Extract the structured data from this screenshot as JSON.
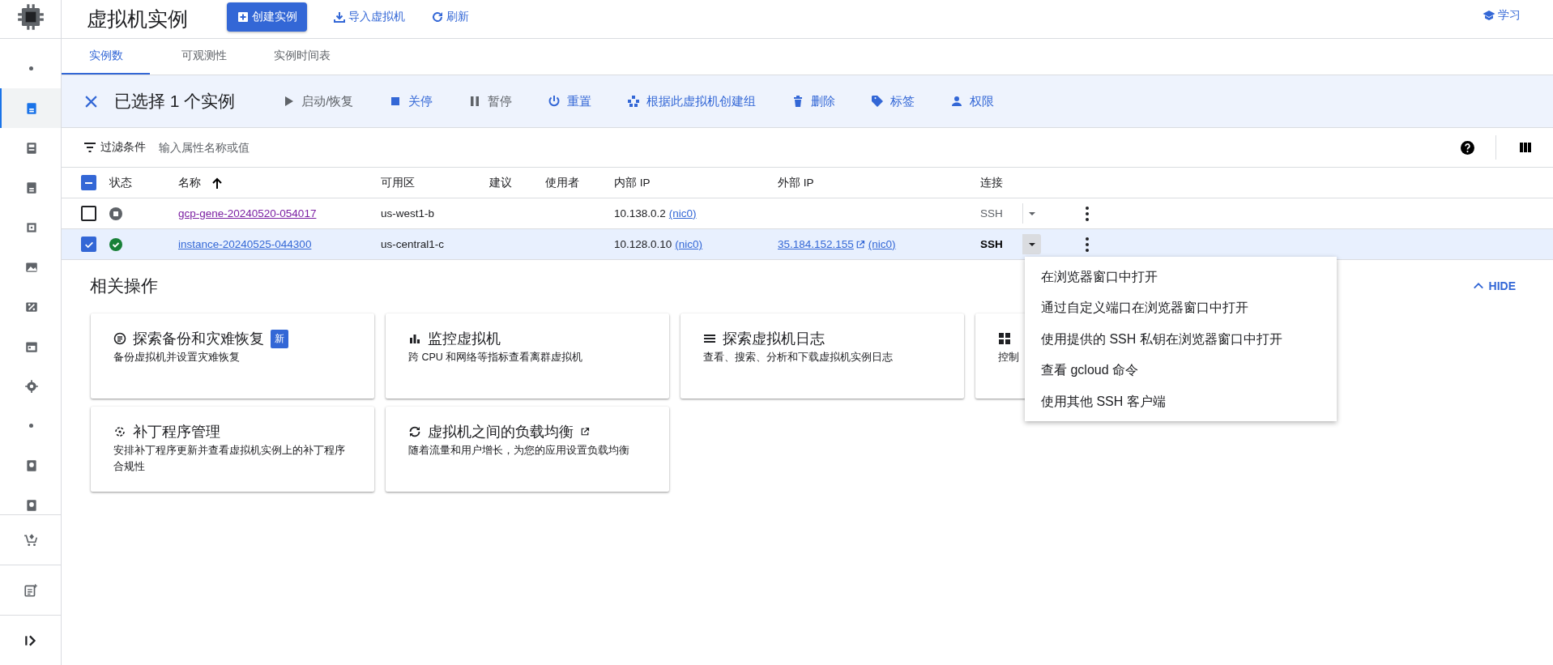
{
  "header": {
    "title": "虚拟机实例",
    "create_button": "创建实例",
    "import_button": "导入虚拟机",
    "refresh_button": "刷新",
    "learn_link": "学习"
  },
  "sidebar": {
    "items": [
      {
        "kind": "dot",
        "selected": false
      },
      {
        "kind": "badge",
        "selected": true
      },
      {
        "kind": "server",
        "selected": false
      },
      {
        "kind": "badge",
        "selected": false
      },
      {
        "kind": "grid",
        "selected": false
      },
      {
        "kind": "image",
        "selected": false
      },
      {
        "kind": "percent",
        "selected": false
      },
      {
        "kind": "calendar",
        "selected": false
      },
      {
        "kind": "chip",
        "selected": false
      },
      {
        "kind": "dot",
        "selected": false
      },
      {
        "kind": "disk",
        "selected": false
      },
      {
        "kind": "disk",
        "selected": false
      }
    ],
    "footer": [
      {
        "kind": "cart"
      },
      {
        "kind": "note"
      },
      {
        "kind": "expand"
      }
    ]
  },
  "tabs": [
    {
      "label": "实例数",
      "selected": true
    },
    {
      "label": "可观测性",
      "selected": false
    },
    {
      "label": "实例时间表",
      "selected": false
    }
  ],
  "selection_bar": {
    "title": "已选择 1 个实例",
    "actions": [
      {
        "kind": "play",
        "label": "启动/恢复",
        "disabled": true
      },
      {
        "kind": "stop",
        "label": "关停",
        "disabled": false
      },
      {
        "kind": "pause",
        "label": "暂停",
        "disabled": true
      },
      {
        "kind": "power",
        "label": "重置",
        "disabled": false
      },
      {
        "kind": "group",
        "label": "根据此虚拟机创建组",
        "disabled": false
      },
      {
        "kind": "trash",
        "label": "删除",
        "disabled": false
      },
      {
        "kind": "tag",
        "label": "标签",
        "disabled": false
      },
      {
        "kind": "person",
        "label": "权限",
        "disabled": false
      }
    ]
  },
  "filter": {
    "label": "过滤条件",
    "placeholder": "输入属性名称或值"
  },
  "table": {
    "select_all_partial": true,
    "columns": [
      {
        "label": "状态",
        "sorted": false
      },
      {
        "label": "名称",
        "sorted": true
      },
      {
        "label": "可用区",
        "sorted": false
      },
      {
        "label": "建议",
        "sorted": false
      },
      {
        "label": "使用者",
        "sorted": false
      },
      {
        "label": "内部 IP",
        "sorted": false
      },
      {
        "label": "外部 IP",
        "sorted": false
      },
      {
        "label": "连接",
        "sorted": false
      }
    ],
    "rows": [
      {
        "selected": false,
        "running": false,
        "name": "gcp-gene-20240520-054017",
        "visited": true,
        "zone": "us-west1-b",
        "internal_ip": "10.138.0.2",
        "internal_nic": "(nic0)",
        "connect": "SSH",
        "connect_enabled": false,
        "menu_open": false
      },
      {
        "selected": true,
        "running": true,
        "name": "instance-20240525-044300",
        "visited": false,
        "zone": "us-central1-c",
        "internal_ip": "10.128.0.10",
        "internal_nic": "(nic0)",
        "external_ip": "35.184.152.155",
        "external_nic": "(nic0)",
        "connect": "SSH",
        "connect_enabled": true,
        "menu_open": true
      }
    ]
  },
  "ssh_menu": [
    "在浏览器窗口中打开",
    "通过自定义端口在浏览器窗口中打开",
    "使用提供的 SSH 私钥在浏览器窗口中打开",
    "查看 gcloud 命令",
    "使用其他 SSH 客户端"
  ],
  "related": {
    "title": "相关操作",
    "hide": "HIDE",
    "cards": [
      {
        "kind": "backup",
        "title": "探索备份和灾难恢复",
        "badge": "新",
        "text": "备份虚拟机并设置灾难恢复"
      },
      {
        "kind": "chart",
        "title": "监控虚拟机",
        "text": "跨 CPU 和网络等指标查看离群虚拟机"
      },
      {
        "kind": "logs",
        "title": "探索虚拟机日志",
        "text": "查看、搜索、分析和下载虚拟机实例日志"
      },
      {
        "kind": "grid",
        "text": "控制"
      },
      {
        "kind": "patch",
        "title": "补丁程序管理",
        "text": "安排补丁程序更新并查看虚拟机实例上的补丁程序合规性"
      },
      {
        "kind": "balance",
        "title": "虚拟机之间的负载均衡",
        "external": true,
        "text": "随着流量和用户增长，为您的应用设置负载均衡"
      }
    ]
  }
}
